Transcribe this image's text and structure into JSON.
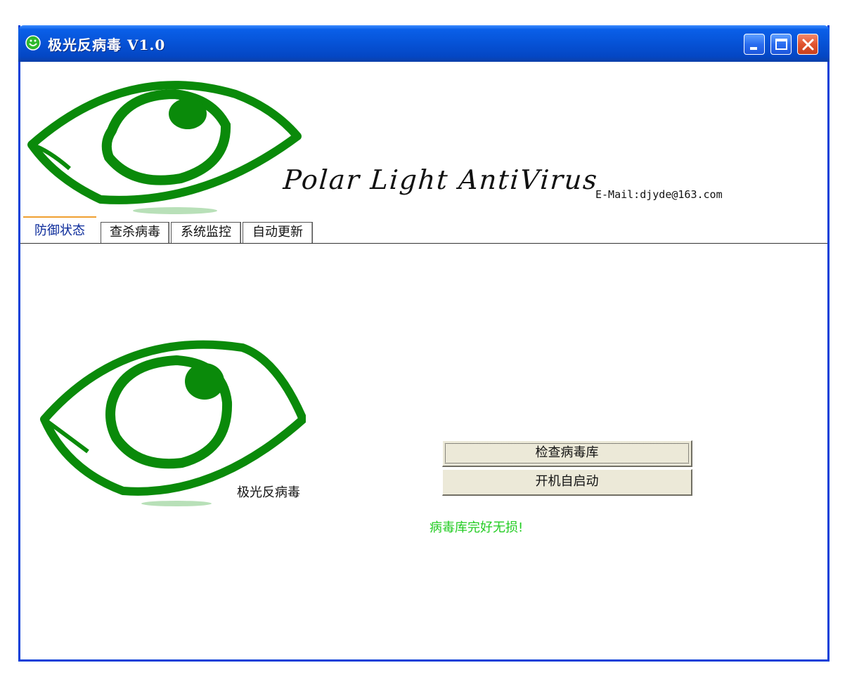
{
  "window": {
    "title": "极光反病毒 V1.0"
  },
  "header": {
    "brand": "Polar Light AntiVirus",
    "email": "E-Mail:djyde@163.com"
  },
  "tabs": [
    {
      "label": "防御状态",
      "active": true
    },
    {
      "label": "查杀病毒",
      "active": false
    },
    {
      "label": "系统监控",
      "active": false
    },
    {
      "label": "自动更新",
      "active": false
    }
  ],
  "panel": {
    "logo_label": "极光反病毒",
    "check_button": "检查病毒库",
    "autostart_button": "开机自启动",
    "status": "病毒库完好无损!"
  },
  "colors": {
    "eye_green": "#0a8a0a",
    "status_green": "#22cc22",
    "titlebar_blue": "#0652d6",
    "active_tab_text": "#0a2a9a"
  },
  "icons": {
    "app": "smiley-icon",
    "minimize": "minimize-icon",
    "maximize": "maximize-icon",
    "close": "close-icon"
  }
}
